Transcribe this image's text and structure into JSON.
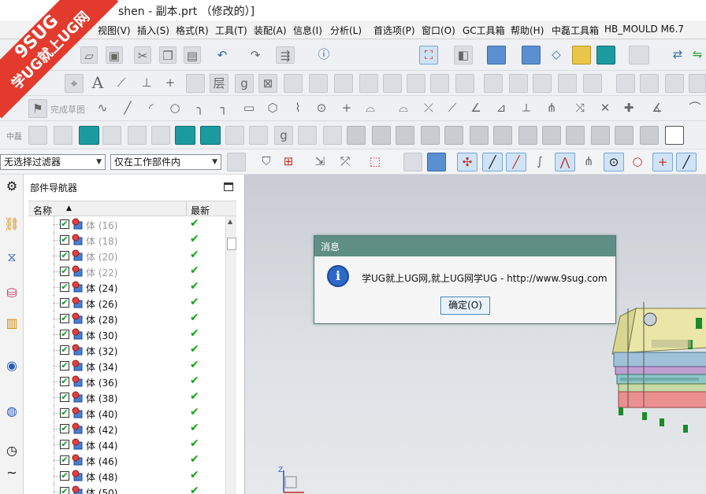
{
  "window": {
    "title": "shen - 副本.prt （修改的）]"
  },
  "menu": [
    "视图(V)",
    "插入(S)",
    "格式(R)",
    "工具(T)",
    "装配(A)",
    "信息(I)",
    "分析(L)",
    "首选项(P)",
    "窗口(O)",
    "GC工具箱",
    "帮助(H)",
    "中磊工具箱",
    "HB_MOULD M6.7"
  ],
  "toolbar": {
    "sketch_label": "完成草图",
    "row4_label": "中磊",
    "filter_value": "无选择过滤器",
    "scope_value": "仅在工作部件内"
  },
  "navigator": {
    "title": "部件导航器",
    "col_name": "名称",
    "col_latest": "最新",
    "rows": [
      {
        "label": "体 (16)",
        "dim": true
      },
      {
        "label": "体 (18)",
        "dim": true
      },
      {
        "label": "体 (20)",
        "dim": true
      },
      {
        "label": "体 (22)",
        "dim": true
      },
      {
        "label": "体 (24)",
        "dim": false
      },
      {
        "label": "体 (26)",
        "dim": false
      },
      {
        "label": "体 (28)",
        "dim": false
      },
      {
        "label": "体 (30)",
        "dim": false
      },
      {
        "label": "体 (32)",
        "dim": false
      },
      {
        "label": "体 (34)",
        "dim": false
      },
      {
        "label": "体 (36)",
        "dim": false
      },
      {
        "label": "体 (38)",
        "dim": false
      },
      {
        "label": "体 (40)",
        "dim": false
      },
      {
        "label": "体 (42)",
        "dim": false
      },
      {
        "label": "体 (44)",
        "dim": false
      },
      {
        "label": "体 (46)",
        "dim": false
      },
      {
        "label": "体 (48)",
        "dim": false
      },
      {
        "label": "体 (50)",
        "dim": false
      }
    ]
  },
  "dialog": {
    "title": "消息",
    "message": "学UG就上UG网,就上UG网学UG - http://www.9sug.com",
    "ok_label": "确定(O)"
  },
  "watermark": {
    "line1": "9SUG",
    "line2": "学UG就上UG网"
  },
  "triad": {
    "axis": "Z"
  },
  "colors": {
    "dialog_title": "#5e8e84",
    "watermark": "#e23b2e",
    "check": "#12a612"
  }
}
